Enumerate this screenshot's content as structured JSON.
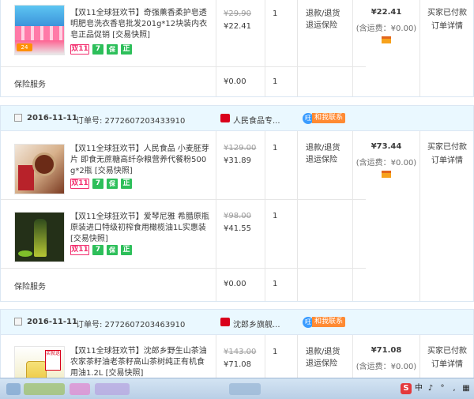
{
  "orders": [
    {
      "items": [
        {
          "tag": "【双11全球狂欢节】",
          "title": "奇强薰香柔护皂透明肥皂洗衣香皂批发201g*12块装内衣皂正品促销 [交易快照]",
          "orig_price": "¥29.90",
          "price": "¥22.41",
          "qty": "1",
          "services": [
            "退款/退货",
            "退运保险"
          ],
          "badges": [
            "双11",
            "7",
            "保",
            "正"
          ]
        }
      ],
      "insurance": {
        "label": "保险服务",
        "price": "¥0.00",
        "qty": "1"
      },
      "total": {
        "amount": "¥22.41",
        "shipping": "(含运费：¥0.00)"
      },
      "status": [
        "买家已付款",
        "订单详情"
      ]
    },
    {
      "date": "2016-11-11",
      "order_no": "订单号: 2772607203433910",
      "shop": "人民食品专...",
      "contact": "和我联系",
      "items": [
        {
          "tag": "【双11全球狂欢节】",
          "title": "人民食品 小麦胚芽片 即食无蔗糖高纤杂粮营养代餐粉500g*2瓶 [交易快照]",
          "orig_price": "¥129.00",
          "price": "¥31.89",
          "qty": "1",
          "services": [
            "退款/退货",
            "退运保险"
          ],
          "badges": [
            "双11",
            "7",
            "保",
            "正"
          ]
        },
        {
          "tag": "【双11全球狂欢节】",
          "title": "爱琴尼雅 希腊原瓶原装进口特级初榨食用橄榄油1L实惠装 [交易快照]",
          "orig_price": "¥98.00",
          "price": "¥41.55",
          "qty": "1",
          "services": [],
          "badges": [
            "双11",
            "7",
            "保",
            "正"
          ]
        }
      ],
      "insurance": {
        "label": "保险服务",
        "price": "¥0.00",
        "qty": "1"
      },
      "total": {
        "amount": "¥73.44",
        "shipping": "(含运费：¥0.00)"
      },
      "status": [
        "买家已付款",
        "订单详情"
      ]
    },
    {
      "date": "2016-11-11",
      "order_no": "订单号: 2772607203463910",
      "shop": "沈郎乡旗舰...",
      "contact": "和我联系",
      "items": [
        {
          "tag": "【双11全球狂欢节】",
          "title": "沈郎乡野生山茶油农家茶籽油老茶籽高山茶树纯正有机食用油1.2L [交易快照]",
          "orig_price": "¥143.00",
          "price": "¥71.08",
          "qty": "1",
          "services": [
            "退款/退货",
            "退运保险"
          ],
          "badges": []
        }
      ],
      "total": {
        "amount": "¥71.08",
        "shipping": "(含运费：¥0.00)"
      },
      "status": [
        "买家已付款",
        "订单详情"
      ]
    }
  ],
  "thumb_text": {
    "soap_sticker": "24",
    "tea_label": "买就送"
  },
  "taskbar": {
    "ime_logo": "S",
    "ime_lang": "中",
    "tray_glyphs": [
      "♪",
      "°",
      ",",
      "▦"
    ]
  },
  "colors": {
    "header_bg": "#eaf8ff",
    "border": "#dbe7f3",
    "badge_green": "#2dbf5a",
    "badge_pink": "#f22e6e",
    "shop_red": "#d9001b"
  }
}
